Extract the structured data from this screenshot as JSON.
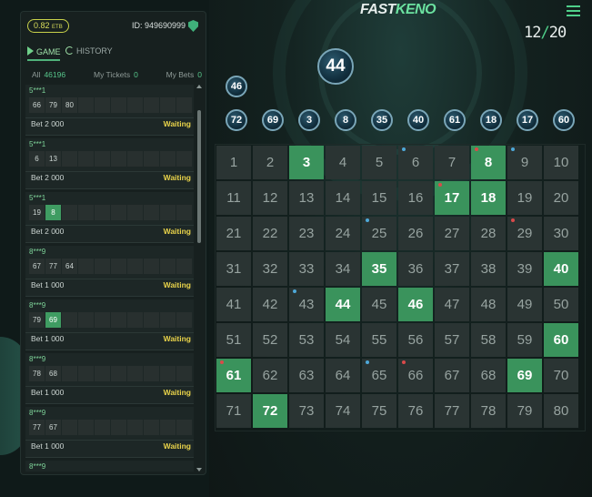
{
  "header": {
    "logo_fast": "FAST",
    "logo_keno": "KENO",
    "round_current": "12",
    "round_total": "20"
  },
  "account": {
    "balance": "0.82",
    "currency": "ETB",
    "user_id": "ID: 949690999"
  },
  "tabs": {
    "game": "GAME",
    "history": "HISTORY"
  },
  "filters": {
    "all_label": "All",
    "all_count": "46196",
    "tickets_label": "My Tickets",
    "tickets_count": "0",
    "bets_label": "My Bets",
    "bets_count": "0"
  },
  "tickets": [
    {
      "user": "5***1",
      "numbers": [
        "66",
        "79",
        "80"
      ],
      "hits": [],
      "bet": "Bet 2 000",
      "status": "Waiting"
    },
    {
      "user": "5***1",
      "numbers": [
        "6",
        "13"
      ],
      "hits": [],
      "bet": "Bet 2 000",
      "status": "Waiting"
    },
    {
      "user": "5***1",
      "numbers": [
        "19",
        "8"
      ],
      "hits": [
        "8"
      ],
      "bet": "Bet 2 000",
      "status": "Waiting"
    },
    {
      "user": "8***9",
      "numbers": [
        "67",
        "77",
        "64"
      ],
      "hits": [],
      "bet": "Bet 1 000",
      "status": "Waiting"
    },
    {
      "user": "8***9",
      "numbers": [
        "79",
        "69"
      ],
      "hits": [
        "69"
      ],
      "bet": "Bet 1 000",
      "status": "Waiting"
    },
    {
      "user": "8***9",
      "numbers": [
        "78",
        "68"
      ],
      "hits": [],
      "bet": "Bet 1 000",
      "status": "Waiting"
    },
    {
      "user": "8***9",
      "numbers": [
        "77",
        "67"
      ],
      "hits": [],
      "bet": "Bet 1 000",
      "status": "Waiting"
    },
    {
      "user": "8***9",
      "numbers": [],
      "hits": [],
      "bet": "",
      "status": ""
    }
  ],
  "draw": {
    "current_ball": "44",
    "previous_ball": "46",
    "drawn_balls": [
      "72",
      "69",
      "3",
      "8",
      "35",
      "40",
      "61",
      "18",
      "17",
      "60"
    ]
  },
  "board": {
    "hits": [
      3,
      8,
      17,
      18,
      35,
      40,
      44,
      46,
      60,
      61,
      69,
      72
    ],
    "red_dots": [
      8,
      17,
      29,
      61,
      66
    ],
    "blue_dots": [
      6,
      9,
      25,
      43,
      65
    ],
    "colors": {
      "hit": "#3a935c",
      "cell": "#2a3433",
      "accent": "#4fd08a",
      "waiting": "#e9d34a"
    }
  }
}
